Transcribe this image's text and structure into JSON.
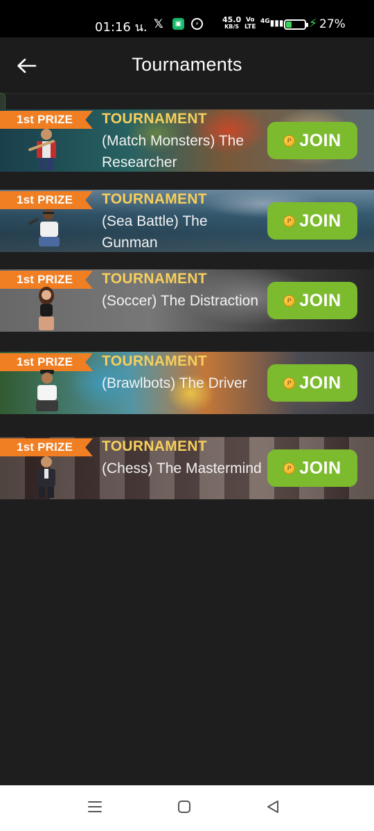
{
  "status_bar": {
    "time": "01:16 น.",
    "speed_value": "45.0",
    "speed_unit": "KB/S",
    "volte_top": "Vo",
    "volte_bottom": "LTE",
    "network": "4G",
    "battery": "27%"
  },
  "header": {
    "title": "Tournaments"
  },
  "tournaments": [
    {
      "badge": "1st PRIZE",
      "label": "TOURNAMENT",
      "name": "(Match Monsters) The Researcher",
      "button": "JOIN"
    },
    {
      "badge": "1st PRIZE",
      "label": "TOURNAMENT",
      "name": "(Sea Battle) The Gunman",
      "button": "JOIN"
    },
    {
      "badge": "1st PRIZE",
      "label": "TOURNAMENT",
      "name": "(Soccer) The Distraction",
      "button": "JOIN"
    },
    {
      "badge": "1st PRIZE",
      "label": "TOURNAMENT",
      "name": "(Brawlbots) The Driver",
      "button": "JOIN"
    },
    {
      "badge": "1st PRIZE",
      "label": "TOURNAMENT",
      "name": "(Chess) The Mastermind",
      "button": "JOIN"
    }
  ],
  "colors": {
    "join_button": "#7cbb2e",
    "prize_ribbon": "#f07f24",
    "tournament_label": "#f6cf5c",
    "background": "#1e1e1e"
  },
  "icons": [
    "back-arrow-icon",
    "coin-icon",
    "recents-icon",
    "home-icon",
    "back-triangle-icon"
  ]
}
